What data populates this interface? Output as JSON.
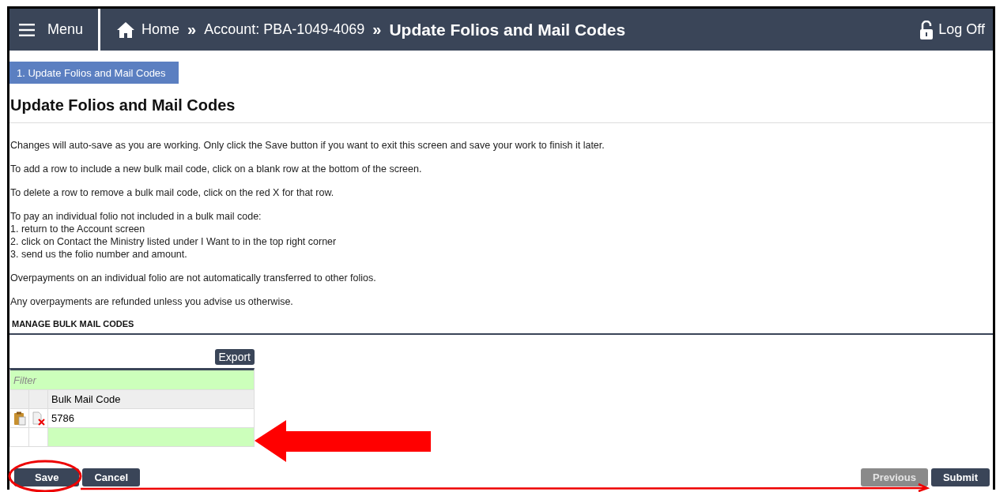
{
  "header": {
    "menu": "Menu",
    "breadcrumbs": [
      {
        "label": "Home",
        "kind": "home"
      },
      {
        "label": "Account: PBA-1049-4069",
        "kind": "link"
      },
      {
        "label": "Update Folios and Mail Codes",
        "kind": "current"
      }
    ],
    "separator": "»",
    "logoff": "Log Off"
  },
  "steps": [
    {
      "label": "1. Update Folios and Mail Codes",
      "selected": true
    }
  ],
  "title": "Update Folios and Mail Codes",
  "instructions": [
    {
      "lines": [
        "Changes will auto-save as you are working. Only click the Save button if you want to exit this screen and save your work to finish it later."
      ]
    },
    {
      "lines": [
        "To add a row to include a new bulk mail code, click on a blank row at the bottom of the screen."
      ]
    },
    {
      "lines": [
        "To delete a row to remove a bulk mail code, click on the red X for that row."
      ]
    },
    {
      "lines": [
        "To pay an individual folio not included in a bulk mail code:",
        "1. return to the Account screen",
        "2. click on Contact the Ministry listed under I Want to in the top right corner",
        "3. send us the folio number and amount."
      ]
    },
    {
      "lines": [
        "Overpayments on an individual folio are not automatically transferred to other folios."
      ]
    },
    {
      "lines": [
        "Any overpayments are refunded unless you advise us otherwise."
      ]
    }
  ],
  "section": "MANAGE BULK MAIL CODES",
  "table": {
    "export": "Export",
    "filter": {
      "placeholder": "Filter"
    },
    "columns": [
      "Bulk Mail Code"
    ],
    "rows": [
      {
        "kind": "data",
        "cells": [
          "5786"
        ]
      },
      {
        "kind": "new",
        "cells": []
      }
    ]
  },
  "left_buttons": [
    {
      "label": "Save",
      "disabled": false
    },
    {
      "label": "Cancel",
      "disabled": false
    }
  ],
  "right_buttons": [
    {
      "label": "Previous",
      "disabled": true
    },
    {
      "label": "Submit",
      "disabled": false
    }
  ]
}
